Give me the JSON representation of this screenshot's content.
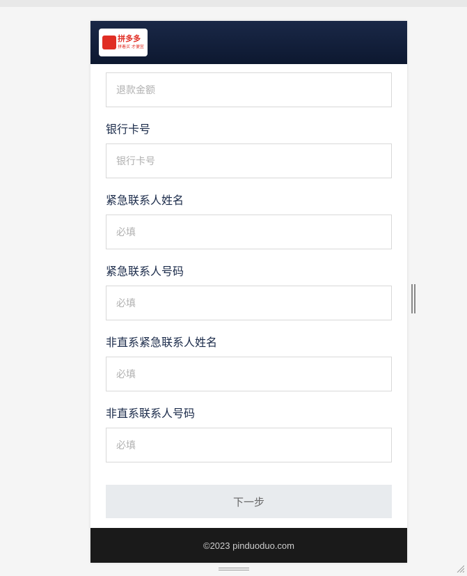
{
  "logo": {
    "brand_text": "拼多多",
    "tagline": "拼着买 才便宜"
  },
  "form": {
    "fields": [
      {
        "label": "",
        "placeholder": "退款金额"
      },
      {
        "label": "银行卡号",
        "placeholder": "银行卡号"
      },
      {
        "label": "紧急联系人姓名",
        "placeholder": "必填"
      },
      {
        "label": "紧急联系人号码",
        "placeholder": "必填"
      },
      {
        "label": "非直系紧急联系人姓名",
        "placeholder": "必填"
      },
      {
        "label": "非直系联系人号码",
        "placeholder": "必填"
      }
    ],
    "submit_label": "下一步"
  },
  "footer": {
    "copyright": "©2023 pinduoduo.com"
  }
}
